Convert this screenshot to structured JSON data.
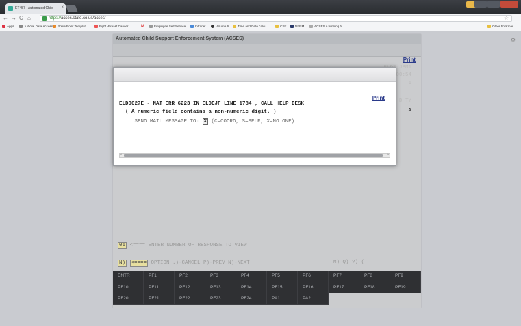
{
  "browser": {
    "tab_title": "ET457 - Automated Child",
    "tab_close": "×",
    "address_scheme": "https://",
    "address_rest": "acses.state.co.us/acses/",
    "bookmarks": [
      {
        "label": "Apps",
        "color": "#d34"
      },
      {
        "label": "Judicial Data Access",
        "color": "#888"
      },
      {
        "label": "PowerPoint Templat...",
        "color": "#e88a2a"
      },
      {
        "label": "Fight -Breast Cancer...",
        "color": "#e55"
      },
      {
        "label": "Employee Self Service",
        "color": "#999"
      },
      {
        "label": "Intranet",
        "color": "#4a8ad8"
      },
      {
        "label": "Volume 6",
        "color": "#333"
      },
      {
        "label": "Time and Date calcu...",
        "color": "#e8c040"
      },
      {
        "label": "CSE",
        "color": "#e8c040"
      },
      {
        "label": "NFRM",
        "color": "#2a3a6a"
      },
      {
        "label": "ACSES A winning h...",
        "color": "#aaa"
      }
    ],
    "other_bookmarks": "Other bookmar"
  },
  "app": {
    "header_title": "Automated Child Support Enforcement System (ACSES)",
    "print_label": "Print",
    "right_codes": [
      "ELDS JBM1",
      "00:54",
      "1"
    ],
    "right_ty": "D TY",
    "right_a": "A",
    "response_prefix": "01",
    "response_text": "<==== ENTER NUMBER OF RESPONSE TO VIEW",
    "option_prefix": "N)",
    "option_arrow": "<====",
    "option_text": " OPTION .)-CANCEL P)-PREV N)-NEXT",
    "option_right": "M) Q) ?) (",
    "pf_keys": [
      "ENTR",
      "PF1",
      "PF2",
      "PF3",
      "PF4",
      "PF5",
      "PF6",
      "PF7",
      "PF8",
      "PF9",
      "PF10",
      "PF11",
      "PF12",
      "PF13",
      "PF14",
      "PF15",
      "PF16",
      "PF17",
      "PF18",
      "PF19",
      "PF20",
      "PF21",
      "PF22",
      "PF23",
      "PF24",
      "PA1",
      "PA2",
      "",
      "",
      ""
    ]
  },
  "modal": {
    "print_label": "Print",
    "error_line": "ELD0027E - NAT ERR 6223 IN ELDEJF LINE 1784 , CALL HELP DESK",
    "detail_line": "  ( A numeric field contains a non-numeric digit. )",
    "mail_prefix": "     SEND MAIL MESSAGE TO: ",
    "mail_value": "X",
    "mail_suffix": " (C=COORD, S=SELF, X=NO ONE)"
  }
}
